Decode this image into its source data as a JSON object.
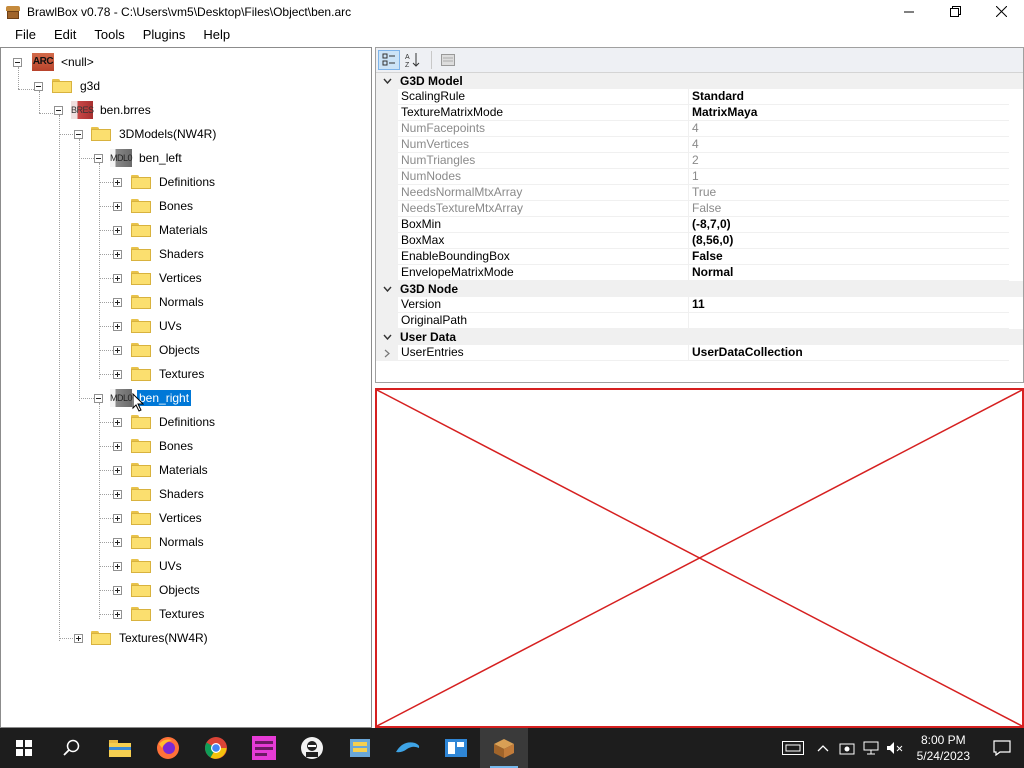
{
  "window": {
    "title": "BrawlBox v0.78 - C:\\Users\\vm5\\Desktop\\Files\\Object\\ben.arc"
  },
  "menu": [
    "File",
    "Edit",
    "Tools",
    "Plugins",
    "Help"
  ],
  "tree": {
    "root": {
      "icon_text": "ARC",
      "label": "<null>"
    },
    "g3d": "g3d",
    "brres": {
      "icon_text": "BRES",
      "label": "ben.brres"
    },
    "models_folder": "3DModels(NW4R)",
    "model_left": {
      "icon_text": "MDL0",
      "label": "ben_left"
    },
    "model_right": {
      "icon_text": "MDL0",
      "label": "ben_right"
    },
    "model_children": [
      "Definitions",
      "Bones",
      "Materials",
      "Shaders",
      "Vertices",
      "Normals",
      "UVs",
      "Objects",
      "Textures"
    ],
    "textures_folder": "Textures(NW4R)"
  },
  "properties": {
    "categories": [
      {
        "name": "G3D Model",
        "rows": [
          {
            "name": "ScalingRule",
            "value": "Standard",
            "readonly": false
          },
          {
            "name": "TextureMatrixMode",
            "value": "MatrixMaya",
            "readonly": false
          },
          {
            "name": "NumFacepoints",
            "value": "4",
            "readonly": true
          },
          {
            "name": "NumVertices",
            "value": "4",
            "readonly": true
          },
          {
            "name": "NumTriangles",
            "value": "2",
            "readonly": true
          },
          {
            "name": "NumNodes",
            "value": "1",
            "readonly": true
          },
          {
            "name": "NeedsNormalMtxArray",
            "value": "True",
            "readonly": true
          },
          {
            "name": "NeedsTextureMtxArray",
            "value": "False",
            "readonly": true
          },
          {
            "name": "BoxMin",
            "value": "(-8,7,0)",
            "readonly": false
          },
          {
            "name": "BoxMax",
            "value": "(8,56,0)",
            "readonly": false
          },
          {
            "name": "EnableBoundingBox",
            "value": "False",
            "readonly": false
          },
          {
            "name": "EnvelopeMatrixMode",
            "value": "Normal",
            "readonly": false
          }
        ]
      },
      {
        "name": "G3D Node",
        "rows": [
          {
            "name": "Version",
            "value": "11",
            "readonly": false
          },
          {
            "name": "OriginalPath",
            "value": "",
            "readonly": false
          }
        ]
      },
      {
        "name": "User Data",
        "rows": [
          {
            "name": "UserEntries",
            "value": "UserDataCollection",
            "readonly": false,
            "expandable": true
          }
        ]
      }
    ]
  },
  "taskbar": {
    "apps": [
      "start-icon",
      "search-icon",
      "file-explorer-icon",
      "firefox-icon",
      "chrome-icon",
      "pink-app-icon",
      "person-app-icon",
      "archive-app-icon",
      "dolphin-icon",
      "store-app-icon",
      "brawlbox-icon"
    ],
    "time": "8:00 PM",
    "date": "5/24/2023"
  },
  "colors": {
    "selection": "#0078d7",
    "preview_border": "#d62020",
    "taskbar": "#1d1d1d"
  }
}
